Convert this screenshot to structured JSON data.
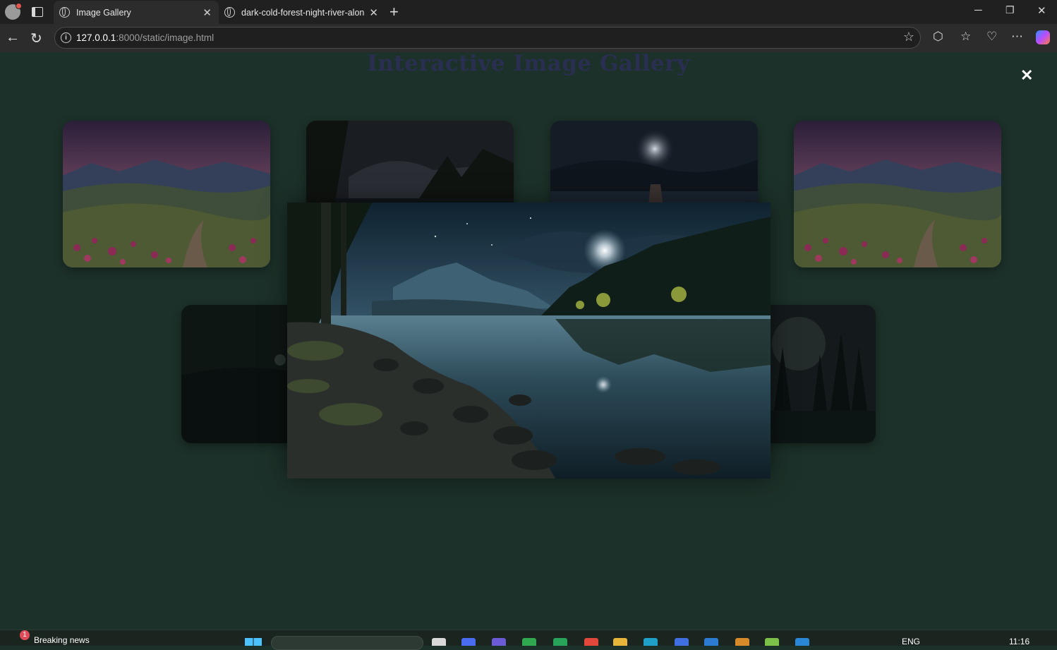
{
  "browser": {
    "tabs": [
      {
        "label": "Image Gallery",
        "active": true
      },
      {
        "label": "dark-cold-forest-night-river-along",
        "active": false
      }
    ],
    "address": {
      "host": "127.0.0.1",
      "path": ":8000/static/image.html"
    }
  },
  "page": {
    "title": "Interactive Image Gallery",
    "close_symbol": "✕"
  },
  "gallery": {
    "thumbnails": [
      {
        "subject": "mountain meadow with flowers at dusk"
      },
      {
        "subject": "dark forest lake at night"
      },
      {
        "subject": "moonlit lake with wooden pier"
      },
      {
        "subject": "mountain meadow with flowers at dusk"
      },
      {
        "subject": "dark hills at night"
      },
      {
        "subject": "full moon over pine forest"
      }
    ],
    "open_image": {
      "subject": "dark cold forest night river with rocky shore"
    }
  },
  "taskbar": {
    "news_count": "1",
    "news_label": "Breaking news",
    "language": "ENG",
    "time": "11:16"
  },
  "colors": {
    "page_background": "#1c3129",
    "title_color": "#2a2f52",
    "chrome_dark": "#202020",
    "accent": "#4cc2ff"
  }
}
